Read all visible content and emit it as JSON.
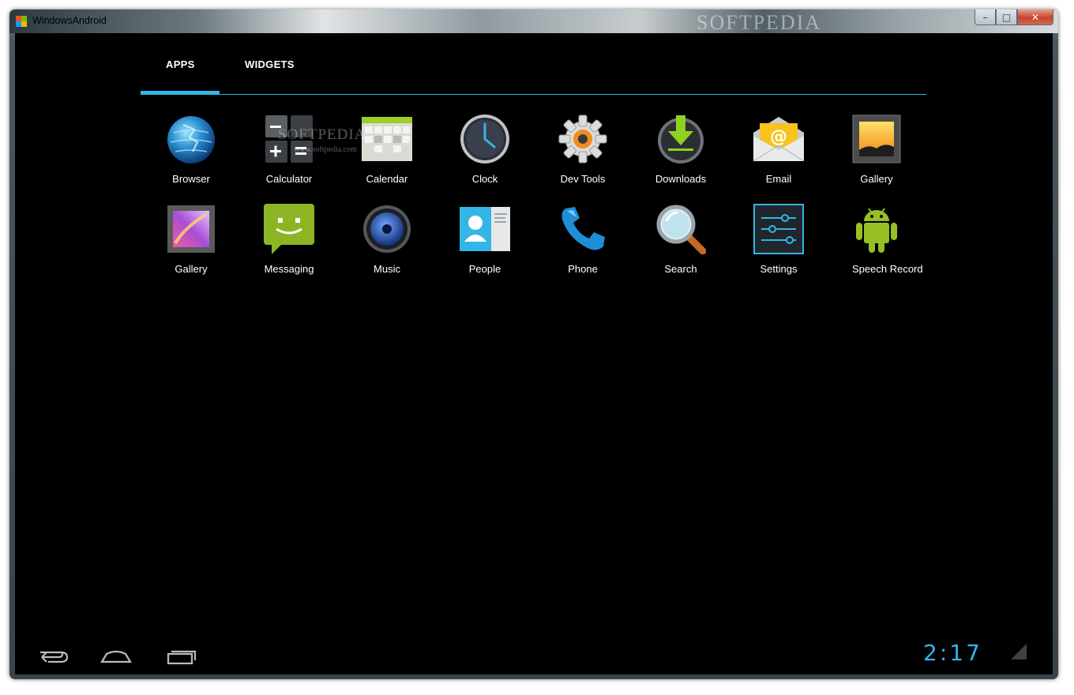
{
  "window": {
    "title": "WindowsAndroid",
    "watermark": "SOFTPEDIA",
    "controls": {
      "minimize": "–",
      "maximize": "□",
      "close": "✕"
    }
  },
  "tabs": [
    {
      "label": "APPS",
      "active": true
    },
    {
      "label": "WIDGETS",
      "active": false
    }
  ],
  "apps": [
    {
      "label": "Browser",
      "icon": "globe-icon"
    },
    {
      "label": "Calculator",
      "icon": "calculator-icon"
    },
    {
      "label": "Calendar",
      "icon": "calendar-icon"
    },
    {
      "label": "Clock",
      "icon": "clock-icon"
    },
    {
      "label": "Dev Tools",
      "icon": "gear-icon"
    },
    {
      "label": "Downloads",
      "icon": "download-icon"
    },
    {
      "label": "Email",
      "icon": "envelope-icon"
    },
    {
      "label": "Gallery",
      "icon": "photo-frame-icon"
    },
    {
      "label": "Gallery",
      "icon": "gallery-icon"
    },
    {
      "label": "Messaging",
      "icon": "speech-bubble-icon"
    },
    {
      "label": "Music",
      "icon": "speaker-icon"
    },
    {
      "label": "People",
      "icon": "contact-card-icon"
    },
    {
      "label": "Phone",
      "icon": "phone-handset-icon"
    },
    {
      "label": "Search",
      "icon": "magnifier-icon"
    },
    {
      "label": "Settings",
      "icon": "sliders-icon"
    },
    {
      "label": "Speech Record",
      "icon": "android-robot-icon"
    }
  ],
  "watermark": {
    "text": "SOFTPEDIA",
    "url": "www.softpedia.com"
  },
  "navbar": {
    "back": "back-icon",
    "home": "home-icon",
    "recents": "recents-icon",
    "clock": "2:17"
  },
  "colors": {
    "accent": "#33b5e5",
    "background": "#000000"
  }
}
